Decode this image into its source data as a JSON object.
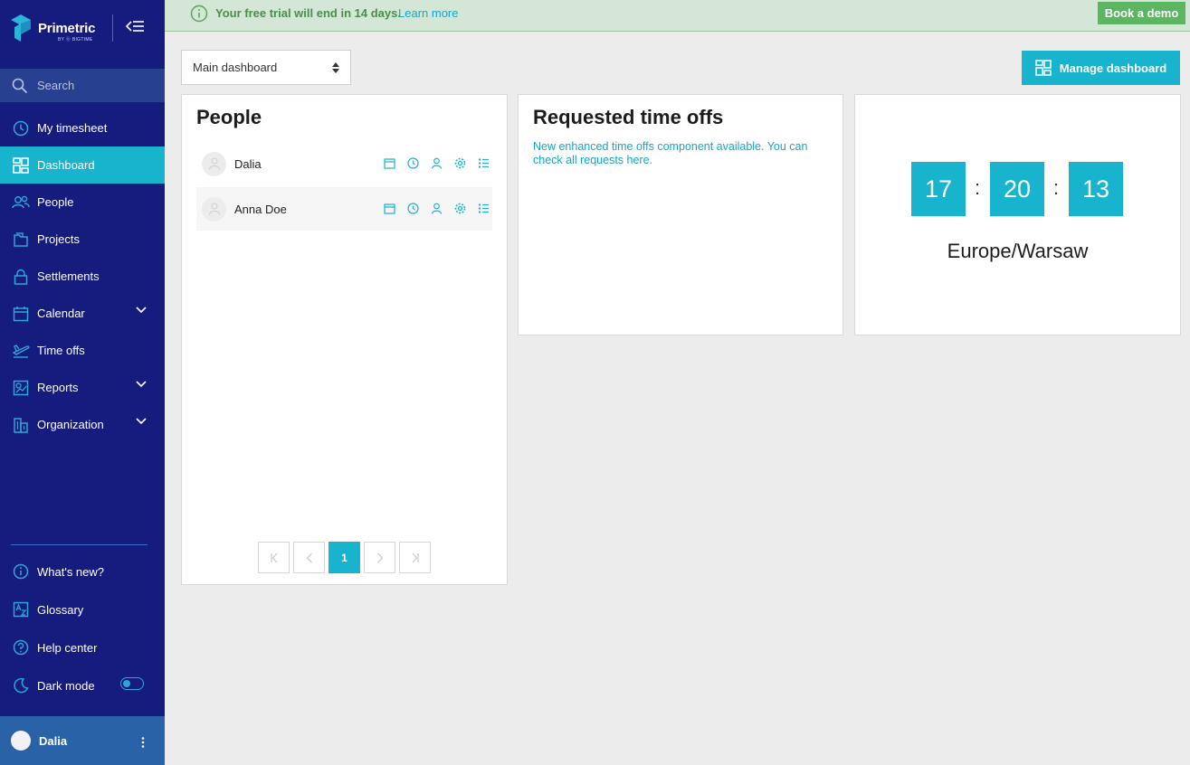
{
  "app": {
    "name": "Primetric",
    "by": "BY ⓑ BIGTIME"
  },
  "sidebar": {
    "search_label": "Search",
    "items": [
      {
        "label": "My timesheet",
        "icon": "clock-icon"
      },
      {
        "label": "Dashboard",
        "icon": "dashboard-icon",
        "active": true
      },
      {
        "label": "People",
        "icon": "people-icon"
      },
      {
        "label": "Projects",
        "icon": "folder-icon"
      },
      {
        "label": "Settlements",
        "icon": "lock-icon"
      },
      {
        "label": "Calendar",
        "icon": "calendar-icon",
        "expandable": true
      },
      {
        "label": "Time offs",
        "icon": "plane-icon"
      },
      {
        "label": "Reports",
        "icon": "report-icon",
        "expandable": true
      },
      {
        "label": "Organization",
        "icon": "building-icon",
        "expandable": true
      }
    ],
    "bottom_items": [
      {
        "label": "What's new?",
        "icon": "info-icon"
      },
      {
        "label": "Glossary",
        "icon": "glossary-icon"
      },
      {
        "label": "Help center",
        "icon": "help-icon"
      },
      {
        "label": "Dark mode",
        "icon": "moon-icon",
        "toggle": false
      }
    ],
    "user": {
      "name": "Dalia"
    }
  },
  "banner": {
    "text": "Your free trial will end in 14 days.",
    "link": "Learn more",
    "button": "Book a demo",
    "color": "#5cb560"
  },
  "toolbar": {
    "dashboard_select": "Main dashboard",
    "manage_button": "Manage dashboard"
  },
  "people_widget": {
    "title": "People",
    "rows": [
      {
        "name": "Dalia"
      },
      {
        "name": "Anna Doe"
      }
    ],
    "row_actions": [
      "calendar-icon",
      "clock-icon",
      "user-icon",
      "gear-icon",
      "list-icon"
    ],
    "pagination": {
      "current_page": "1"
    }
  },
  "timeoffs_widget": {
    "title": "Requested time offs",
    "message": "New enhanced time offs component available. You can check all requests here."
  },
  "clock_widget": {
    "hours": "17",
    "minutes": "20",
    "seconds": "13",
    "separator": ":",
    "timezone": "Europe/Warsaw"
  },
  "colors": {
    "sidebar": "#161b7e",
    "accent": "#18b4ce",
    "banner_bg": "#d4e6d5"
  }
}
